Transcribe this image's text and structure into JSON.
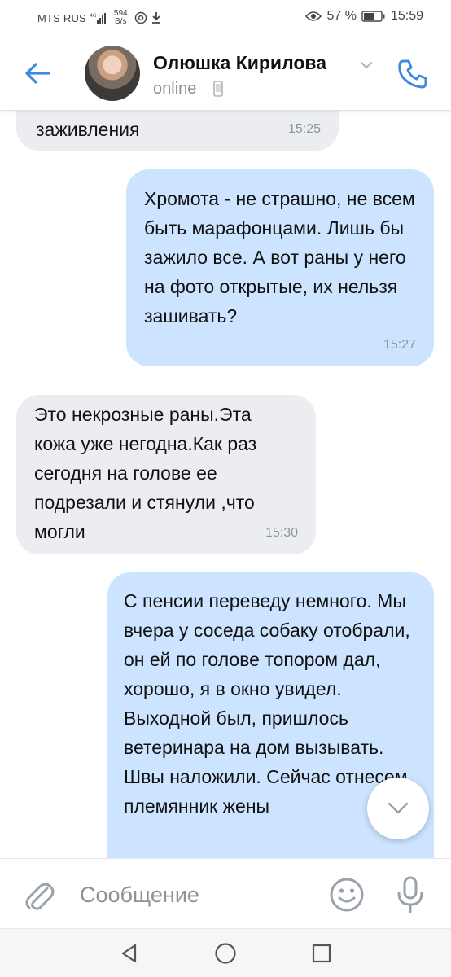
{
  "status_bar": {
    "carrier": "MTS RUS",
    "network_speed_value": "594",
    "network_speed_unit": "B/s",
    "battery": "57 %",
    "time": "15:59"
  },
  "header": {
    "contact_name": "Олюшка Кирилова",
    "status": "online"
  },
  "messages": [
    {
      "direction": "in",
      "text": "заживления",
      "time": "15:25"
    },
    {
      "direction": "out",
      "text": "Хромота - не страшно, не всем быть марафонцами. Лишь бы зажило все. А вот раны у него на фото открытые, их нельзя зашивать?",
      "time": "15:27"
    },
    {
      "direction": "in",
      "text": "Это некрозные раны.Эта кожа уже негодна.Как раз сегодня на голове ее подрезали и стянули ,что могли",
      "time": "15:30"
    },
    {
      "direction": "out",
      "text": "С пенсии переведу немного. Мы вчера  у соседа собаку отобрали, он ей по голове топором дал, хорошо, я в окно увидел. Выходной был, пришлось ветеринара на дом вызывать. Швы наложили. Сейчас отнесем, племянник жены",
      "time": ""
    }
  ],
  "composer": {
    "placeholder": "Сообщение"
  },
  "icons": {
    "back": "arrow-left-icon",
    "call": "phone-icon",
    "attach": "paperclip-icon",
    "emoji": "smile-icon",
    "mic": "microphone-icon",
    "scroll": "chevron-down-icon"
  },
  "colors": {
    "accent": "#3f8ae0",
    "incoming_bubble": "#ecedf1",
    "outgoing_bubble": "#cce4ff"
  }
}
